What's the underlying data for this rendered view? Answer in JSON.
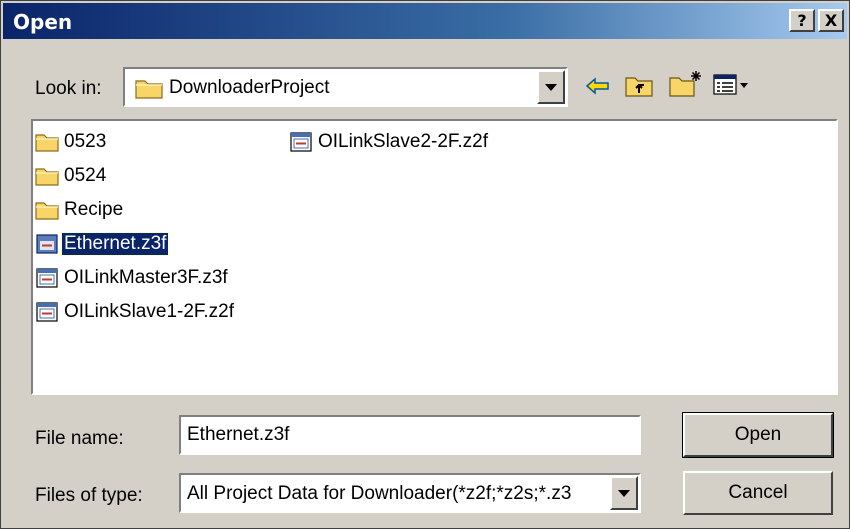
{
  "window": {
    "title": "Open",
    "help_label": "?",
    "close_label": "X"
  },
  "toolbar": {
    "look_in_label": "Look in:",
    "look_in_value": "DownloaderProject",
    "icons": [
      "back-arrow-icon",
      "up-folder-icon",
      "new-folder-icon",
      "view-menu-icon"
    ]
  },
  "files": [
    {
      "name": "0523",
      "type": "folder",
      "icon": "folder-icon",
      "selected": false
    },
    {
      "name": "0524",
      "type": "folder",
      "icon": "folder-icon",
      "selected": false
    },
    {
      "name": "Recipe",
      "type": "folder",
      "icon": "folder-icon",
      "selected": false
    },
    {
      "name": "Ethernet.z3f",
      "type": "file",
      "icon": "project-file-icon",
      "selected": true
    },
    {
      "name": "OILinkMaster3F.z3f",
      "type": "file",
      "icon": "project-file-icon",
      "selected": false
    },
    {
      "name": "OILinkSlave1-2F.z2f",
      "type": "file",
      "icon": "project-file-icon",
      "selected": false
    },
    {
      "name": "OILinkSlave2-2F.z2f",
      "type": "file",
      "icon": "project-file-icon",
      "selected": false
    }
  ],
  "form": {
    "file_name_label": "File name:",
    "file_name_value": "Ethernet.z3f",
    "files_of_type_label": "Files of type:",
    "files_of_type_value": "All Project Data for Downloader(*z2f;*z2s;*.z3"
  },
  "buttons": {
    "open_label": "Open",
    "cancel_label": "Cancel"
  },
  "colors": {
    "title_bar": "#0a246a",
    "selection": "#0a246a",
    "dialog_face": "#d4d0c8",
    "folder": "#f8d568"
  }
}
